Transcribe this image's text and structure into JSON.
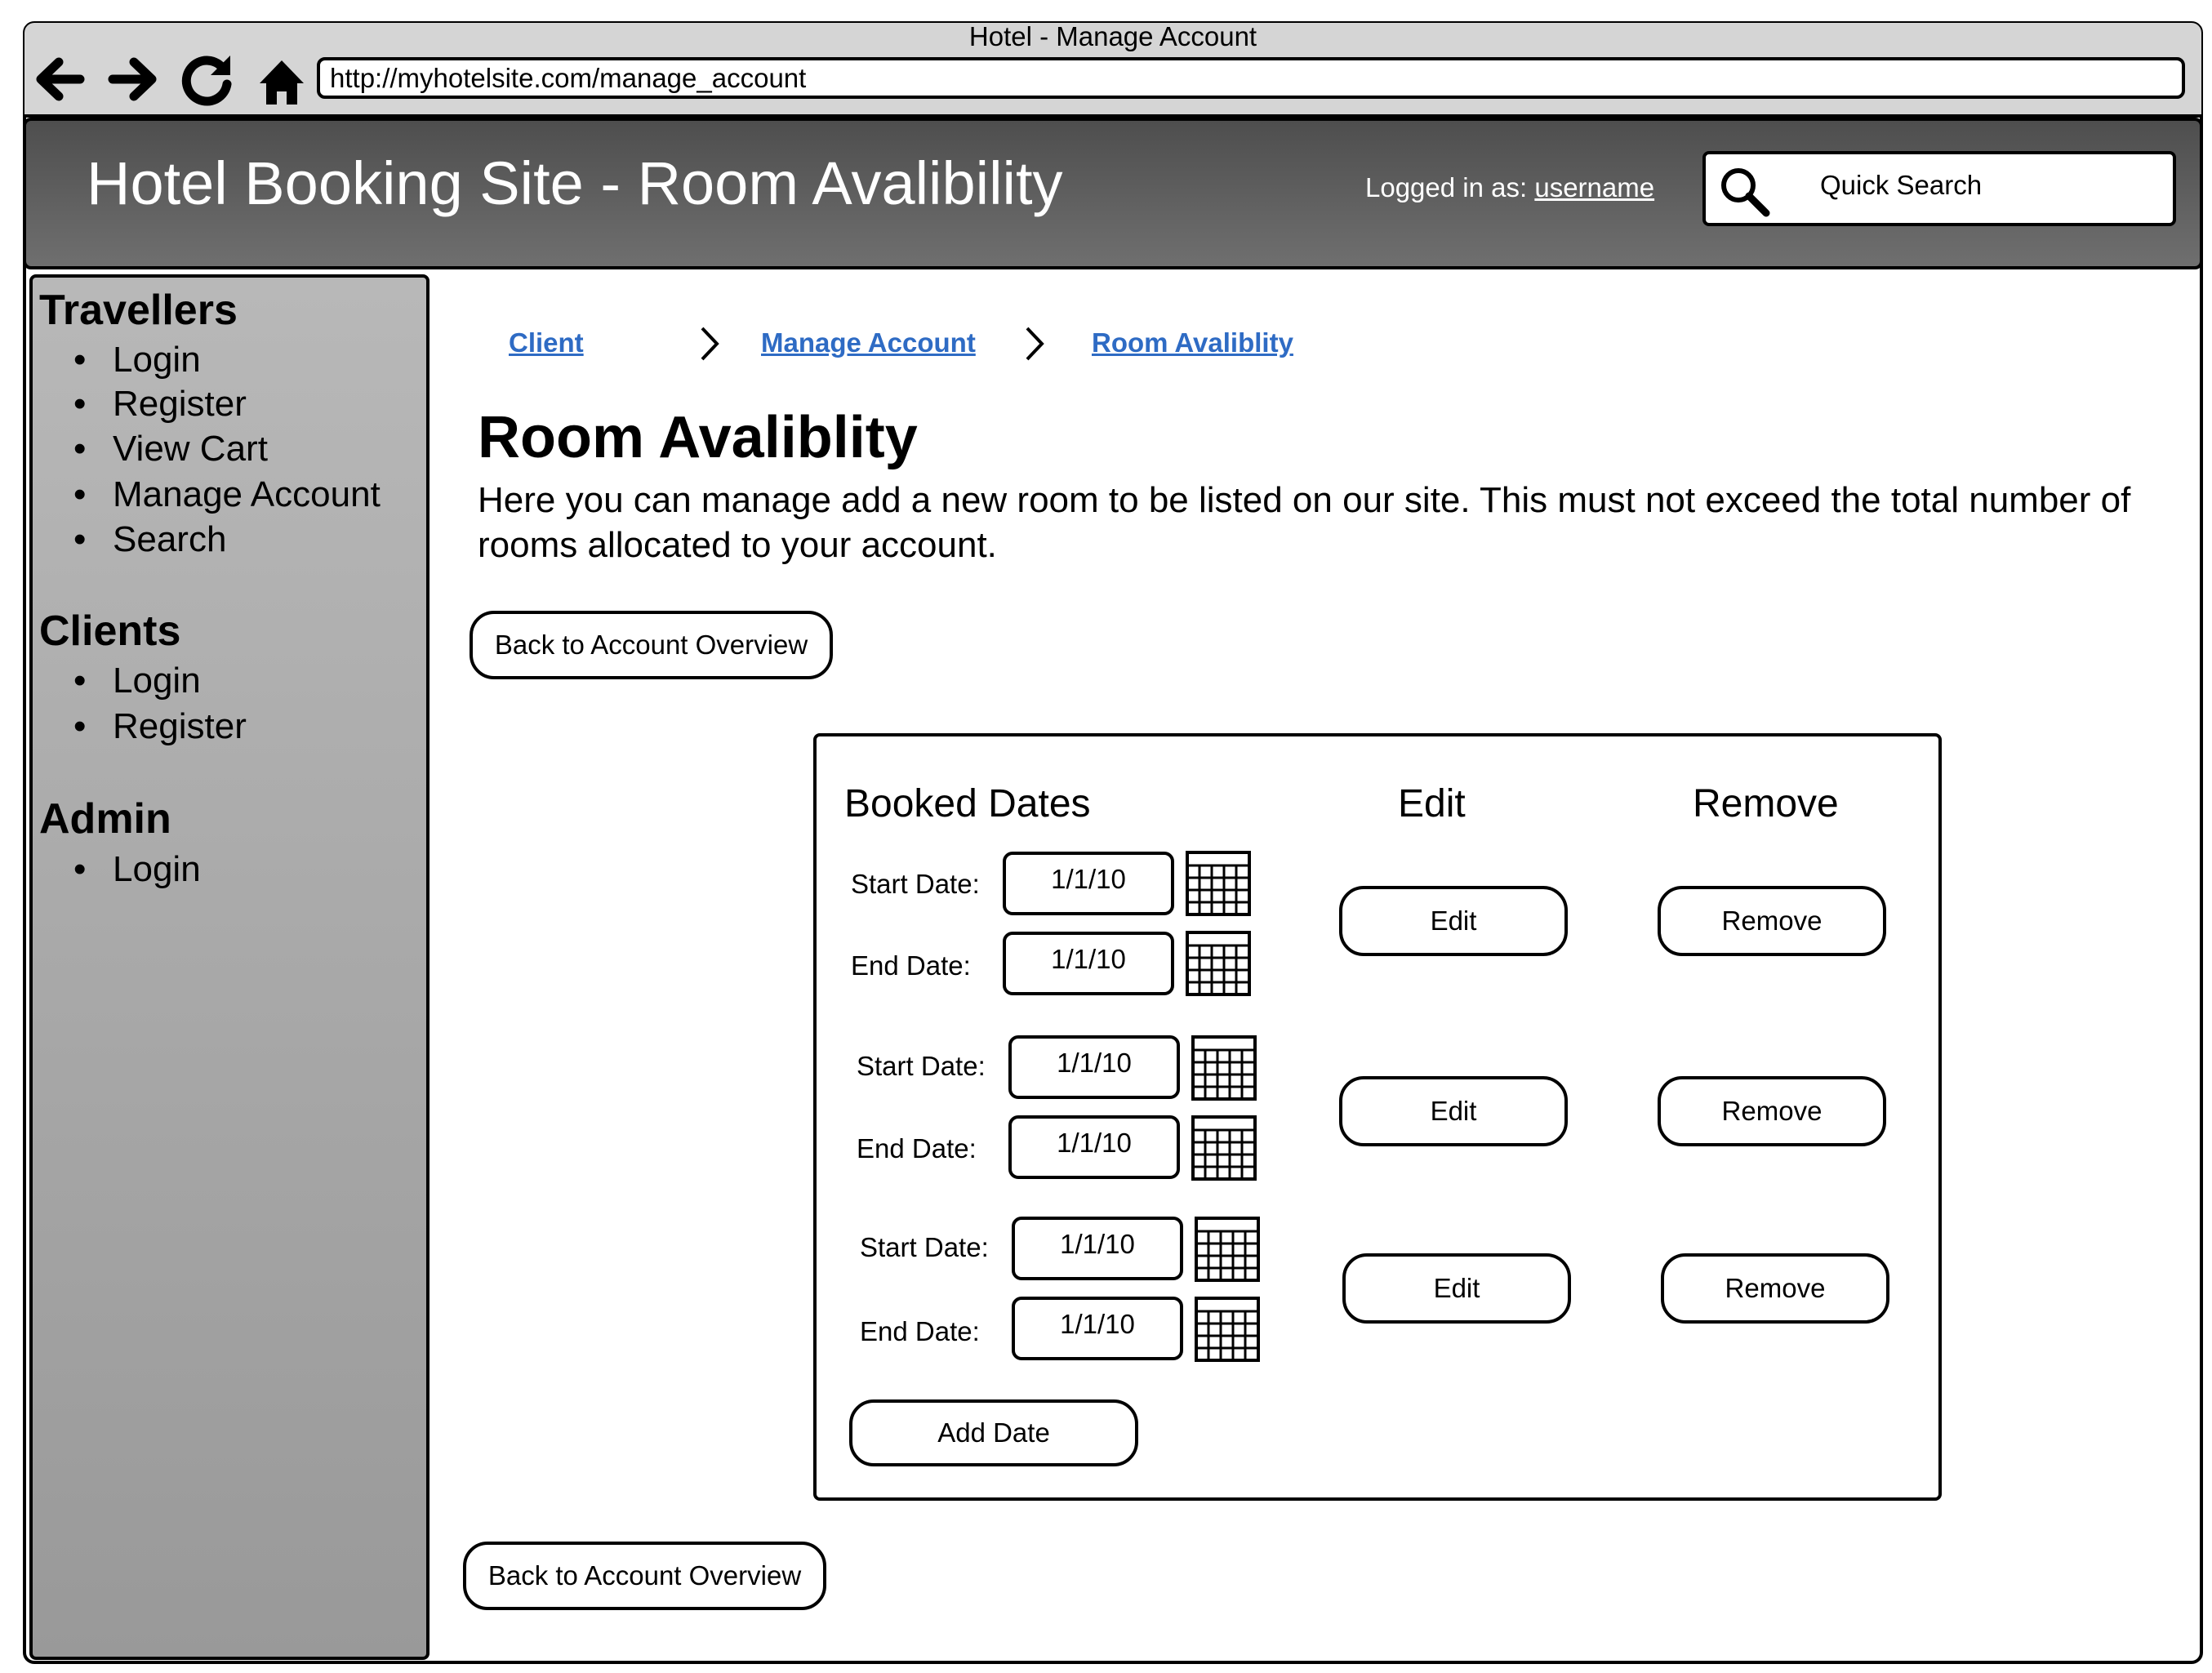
{
  "browser": {
    "window_title": "Hotel - Manage Account",
    "url": "http://myhotelsite.com/manage_account"
  },
  "header": {
    "title": "Hotel Booking Site - Room Avalibility",
    "login_prefix": "Logged in as: ",
    "username": "username",
    "search_label": "Quick Search"
  },
  "sidebar": {
    "sections": [
      {
        "heading": "Travellers",
        "items": [
          "Login",
          "Register",
          "View Cart",
          "Manage Account",
          "Search"
        ]
      },
      {
        "heading": "Clients",
        "items": [
          "Login",
          "Register"
        ]
      },
      {
        "heading": "Admin",
        "items": [
          "Login"
        ]
      }
    ]
  },
  "breadcrumb": [
    "Client",
    "Manage Account",
    "Room Avaliblity"
  ],
  "main": {
    "heading": "Room Avaliblity",
    "description": "Here you can manage add a new room to be listed on our site. This must not exceed the total number of rooms allocated to your account.",
    "back_button_label": "Back to Account Overview"
  },
  "panel": {
    "columns": {
      "booked_dates": "Booked Dates",
      "edit": "Edit",
      "remove": "Remove"
    },
    "start_label": "Start Date:",
    "end_label": "End Date:",
    "edit_button_label": "Edit",
    "remove_button_label": "Remove",
    "add_button_label": "Add Date",
    "bookings": [
      {
        "start": "1/1/10",
        "end": "1/1/10"
      },
      {
        "start": "1/1/10",
        "end": "1/1/10"
      },
      {
        "start": "1/1/10",
        "end": "1/1/10"
      }
    ]
  }
}
